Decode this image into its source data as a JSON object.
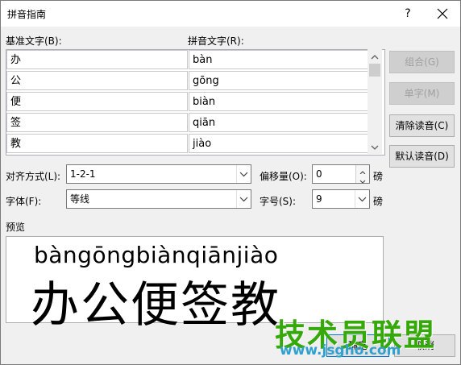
{
  "window": {
    "title": "拼音指南",
    "help_label": "?"
  },
  "labels": {
    "base_text": "基准文字(B):",
    "pinyin_text": "拼音文字(R):",
    "alignment": "对齐方式(L):",
    "offset": "偏移量(O):",
    "font": "字体(F):",
    "size": "字号(S):",
    "preview": "预览",
    "unit_offset": "磅",
    "unit_size": "磅"
  },
  "rows": [
    {
      "base": "办",
      "pinyin": "bàn"
    },
    {
      "base": "公",
      "pinyin": "gōng"
    },
    {
      "base": "便",
      "pinyin": "biàn"
    },
    {
      "base": "签",
      "pinyin": "qiān"
    },
    {
      "base": "教",
      "pinyin": "jiào"
    }
  ],
  "side_buttons": {
    "combine": "组合(G)",
    "single": "单字(M)",
    "clear": "清除读音(C)",
    "default": "默认读音(D)"
  },
  "fields": {
    "alignment_value": "1-2-1",
    "offset_value": "0",
    "font_value": "等线",
    "size_value": "9"
  },
  "preview": {
    "pinyin": "bàngōngbiànqiānjiào",
    "hanzi": "办公便签教"
  },
  "bottom_buttons": {
    "ok": "确定",
    "cancel": "取消"
  },
  "watermark": {
    "text": "技术员联盟",
    "url": "www.jsgho.com"
  }
}
